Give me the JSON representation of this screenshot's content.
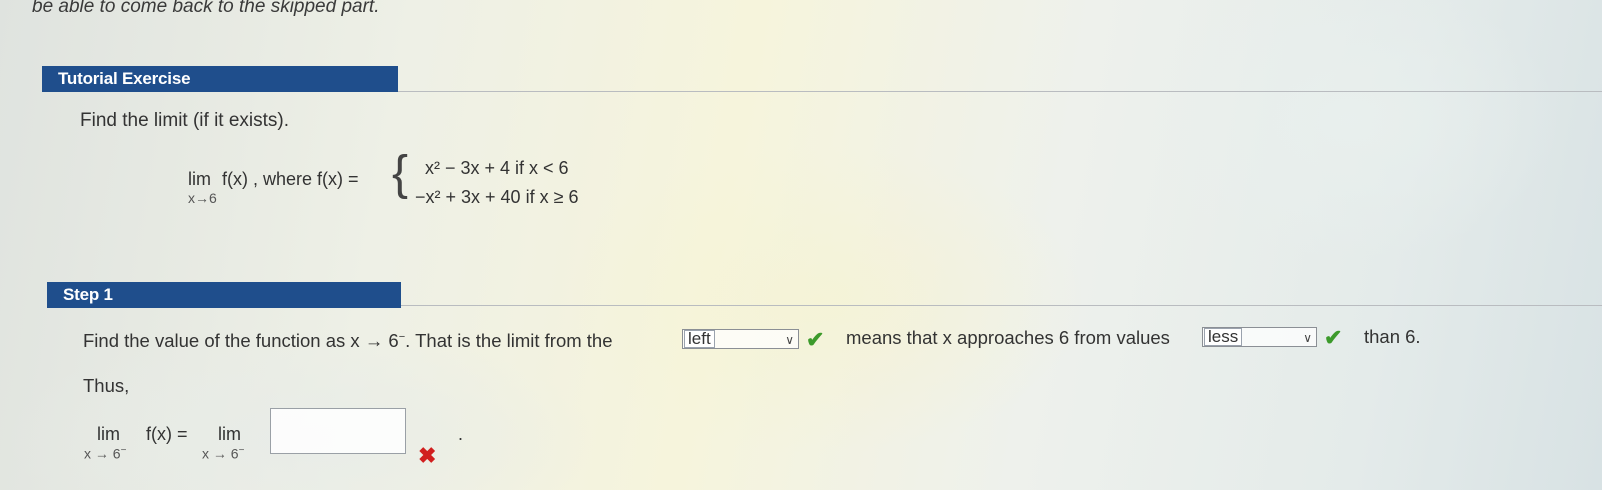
{
  "header_text": "be able to come back to the skipped part.",
  "tutorial": {
    "title": "Tutorial Exercise",
    "prompt": "Find the limit (if it exists).",
    "lim_word": "lim",
    "lim_sub": "x→6",
    "expr": "f(x) , where f(x) =",
    "case1": "x² − 3x + 4 if x < 6",
    "case2": "−x² + 3x + 40 if x ≥ 6"
  },
  "step1": {
    "title": "Step 1",
    "text_a": "Find the value of the function as x → 6",
    "minus_sup": "−",
    "text_b": ". That is the limit from the",
    "dropdown1_value": "left",
    "text_c": "means that x approaches 6 from values",
    "dropdown2_value": "less",
    "text_d": "than 6.",
    "thus": "Thus,",
    "lim_word": "lim",
    "lim_sub": "x → 6",
    "lim_left_expr": "f(x)  =",
    "answer_value": "",
    "period": "."
  },
  "icons": {
    "check": "✔",
    "cross": "✖",
    "chevron": "∨"
  },
  "colors": {
    "header_bar": "#1f4e8c",
    "check": "#3c9a2b",
    "cross": "#d11f1f"
  }
}
